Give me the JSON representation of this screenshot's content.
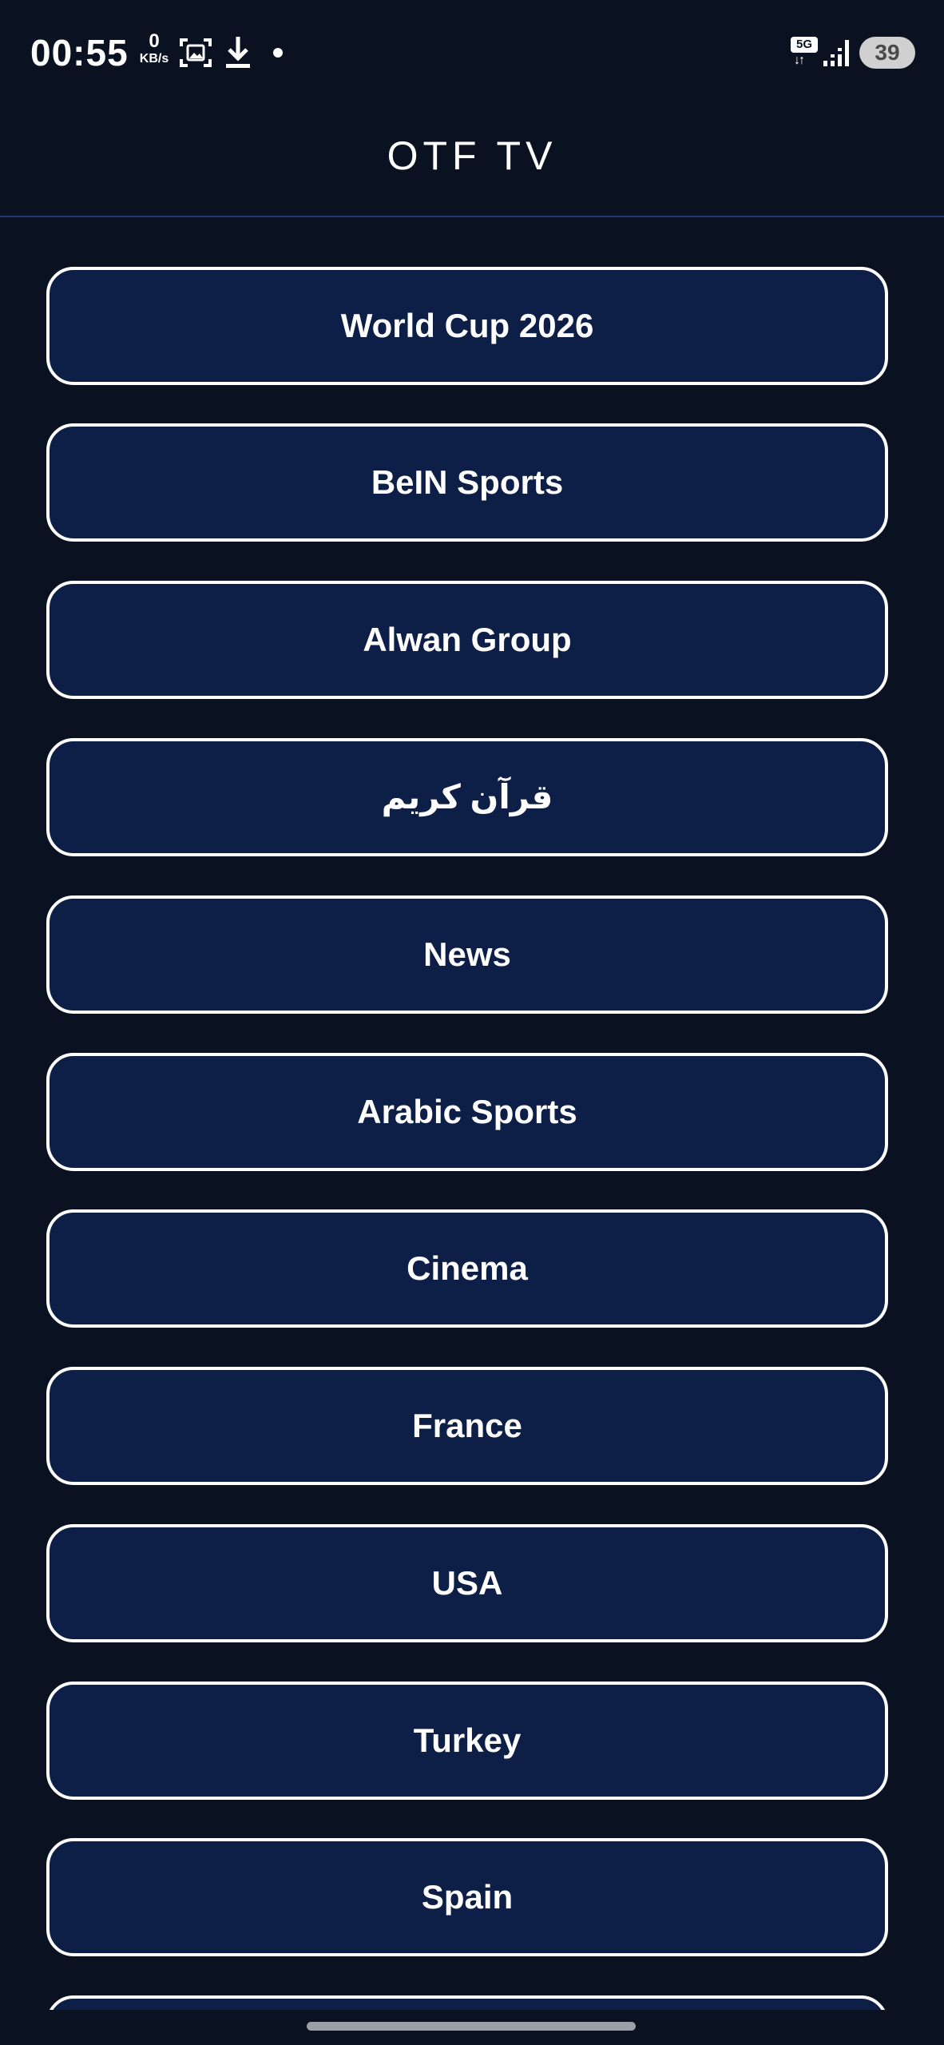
{
  "status_bar": {
    "time": "00:55",
    "net_speed_value": "0",
    "net_speed_unit": "KB/s",
    "network_type": "5G",
    "battery_level": "39"
  },
  "header": {
    "title": "OTF TV"
  },
  "categories": [
    "World Cup 2026",
    "BeIN Sports",
    "Alwan Group",
    "قرآن كريم",
    "News",
    "Arabic Sports",
    "Cinema",
    "France",
    "USA",
    "Turkey",
    "Spain"
  ],
  "colors": {
    "background": "#0a1222",
    "button_fill": "#0e1f47",
    "button_border": "#ffffff",
    "header_divider": "#1e3a72"
  },
  "icons": [
    "screenshot-icon",
    "download-icon",
    "notification-dot-icon",
    "5g-icon",
    "signal-icon",
    "battery-icon"
  ]
}
